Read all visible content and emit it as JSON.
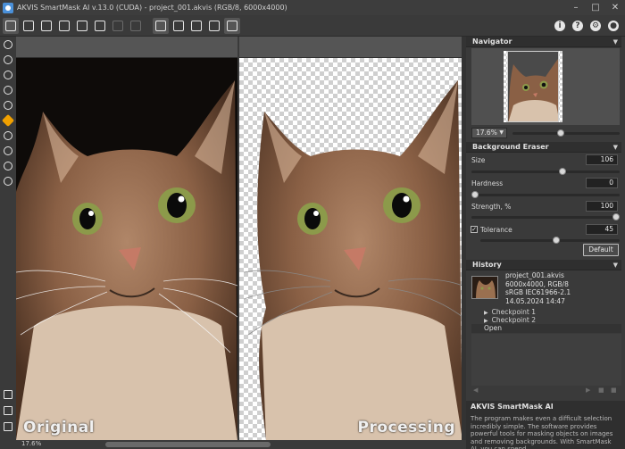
{
  "window": {
    "title": "AKVIS SmartMask AI v.13.0 (CUDA) - project_001.akvis (RGB/8, 6000x4000)",
    "minimize": "–",
    "maximize": "□",
    "close": "✕"
  },
  "toolbar": {
    "left_icons": [
      "home-icon",
      "open-icon",
      "save-icon",
      "print-icon",
      "camera-icon",
      "share-icon",
      "undo-icon",
      "redo-icon",
      "tool-a-icon",
      "tool-b-icon",
      "tool-c-icon",
      "tool-d-icon",
      "view-toggle-icon"
    ],
    "right": {
      "info": "i",
      "help": "?",
      "settings": "⚙",
      "notify": "●"
    }
  },
  "canvas": {
    "left_label": "Original",
    "right_label": "Processing"
  },
  "status": {
    "zoom": "17.6%"
  },
  "navigator": {
    "header": "Navigator",
    "zoom": "17.6%",
    "zoom_slider": 0.45
  },
  "eraser": {
    "header": "Background Eraser",
    "size_label": "Size",
    "size_value": "106",
    "size_slider": 0.62,
    "hardness_label": "Hardness",
    "hardness_value": "0",
    "hardness_slider": 0.0,
    "strength_label": "Strength, %",
    "strength_value": "100",
    "strength_slider": 1.0,
    "tolerance_label": "Tolerance",
    "tolerance_value": "45",
    "tolerance_checked": "✓",
    "tolerance_slider": 0.55,
    "default_button": "Default"
  },
  "history": {
    "header": "History",
    "file_name": "project_001.akvis",
    "dims": "6000x4000, RGB/8",
    "profile": "sRGB IEC61966-2.1",
    "date": "14.05.2024 14:47",
    "checkpoint1": "Checkpoint 1",
    "checkpoint2": "Checkpoint 2",
    "open": "Open"
  },
  "about": {
    "title": "AKVIS SmartMask AI",
    "text": "The program makes even a difficult selection incredibly simple. The software provides powerful tools for masking objects on images and removing backgrounds. With SmartMask AI, you can spend"
  },
  "colors": {
    "accent": "#f0a000",
    "panel": "#3a3a3a",
    "header": "#2f2f2f"
  }
}
